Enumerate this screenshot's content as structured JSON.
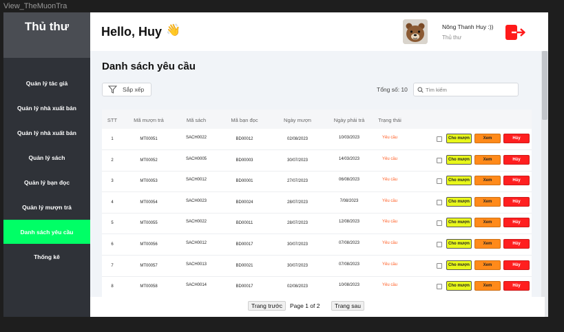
{
  "frame_label": "View_TheMuonTra",
  "sidebar": {
    "brand": "Thủ thư",
    "items": [
      {
        "label": "Quản lý tác giả"
      },
      {
        "label": "Quản lý nhà xuất bản"
      },
      {
        "label": "Quản lý nhà xuất bản"
      },
      {
        "label": "Quản lý sách"
      },
      {
        "label": "Quản lý bạn đọc"
      },
      {
        "label": "Quản lý mượn trả"
      },
      {
        "label": "Danh sách yêu cầu",
        "active": true
      },
      {
        "label": "Thống kê"
      }
    ],
    "accent_color": "#00ff66"
  },
  "header": {
    "greeting": "Hello, Huy",
    "wave": "👋",
    "user_name": "Nông Thanh Huy :))",
    "user_role": "Thủ thư",
    "avatar_icon": "bear-avatar-icon",
    "logout_icon": "logout-icon"
  },
  "main": {
    "title": "Danh sách yêu cầu",
    "sort_label": "Sắp xếp",
    "total_label": "Tổng số: 10",
    "search_placeholder": "Tìm kiếm"
  },
  "table": {
    "headers": [
      "STT",
      "Mã mượn trả",
      "Mã sách",
      "Mã bạn đọc",
      "Ngày mượn",
      "Ngày phải trả",
      "Trạng thái"
    ],
    "action_labels": {
      "approve": "Cho mượn",
      "view": "Xem",
      "cancel": "Hủy"
    },
    "rows": [
      {
        "stt": "1",
        "ma_muon_tra": "MT00051",
        "ma_sach": "SACH0022",
        "ma_ban_doc": "BD00012",
        "ngay_muon": "02/08/2023",
        "ngay_phai_tra": "10/03/2023",
        "trang_thai": "Yêu cầu"
      },
      {
        "stt": "2",
        "ma_muon_tra": "MT00052",
        "ma_sach": "SACH0005",
        "ma_ban_doc": "BD00003",
        "ngay_muon": "30/07/2023",
        "ngay_phai_tra": "14/03/2023",
        "trang_thai": "Yêu cầu"
      },
      {
        "stt": "3",
        "ma_muon_tra": "MT00053",
        "ma_sach": "SACH0012",
        "ma_ban_doc": "BD00001",
        "ngay_muon": "27/07/2023",
        "ngay_phai_tra": "06/08/2023",
        "trang_thai": "Yêu cầu"
      },
      {
        "stt": "4",
        "ma_muon_tra": "MT00054",
        "ma_sach": "SACH0023",
        "ma_ban_doc": "BD00024",
        "ngay_muon": "28/07/2023",
        "ngay_phai_tra": "7/08/2023",
        "trang_thai": "Yêu cầu"
      },
      {
        "stt": "5",
        "ma_muon_tra": "MT00055",
        "ma_sach": "SACH0022",
        "ma_ban_doc": "BD00011",
        "ngay_muon": "28/07/2023",
        "ngay_phai_tra": "12/08/2023",
        "trang_thai": "Yêu cầu"
      },
      {
        "stt": "6",
        "ma_muon_tra": "MT00056",
        "ma_sach": "SACH0012",
        "ma_ban_doc": "BD00017",
        "ngay_muon": "30/07/2023",
        "ngay_phai_tra": "07/08/2023",
        "trang_thai": "Yêu cầu"
      },
      {
        "stt": "7",
        "ma_muon_tra": "MT00057",
        "ma_sach": "SACH0013",
        "ma_ban_doc": "BD00021",
        "ngay_muon": "30/07/2023",
        "ngay_phai_tra": "07/08/2023",
        "trang_thai": "Yêu cầu"
      },
      {
        "stt": "8",
        "ma_muon_tra": "MT00058",
        "ma_sach": "SACH0014",
        "ma_ban_doc": "BD00017",
        "ngay_muon": "02/08/2023",
        "ngay_phai_tra": "10/08/2023",
        "trang_thai": "Yêu cầu"
      }
    ],
    "status_color": "#ff5a1f"
  },
  "pager": {
    "prev_label": "Trang trước",
    "info": "Page 1 of 2",
    "next_label": "Trang sau"
  }
}
